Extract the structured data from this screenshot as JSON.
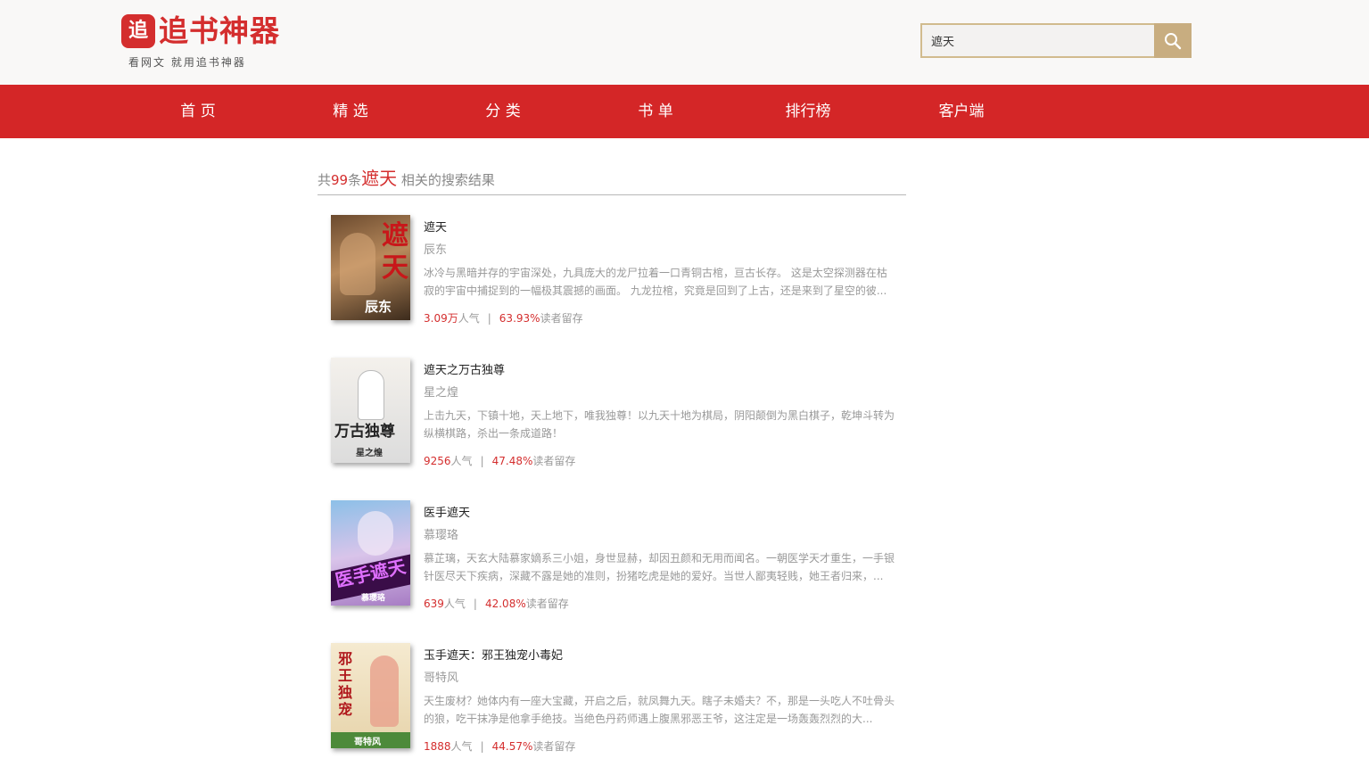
{
  "header": {
    "logo_mark": "追",
    "logo_name": "追书神器",
    "slogan": "看网文 就用追书神器",
    "search": {
      "value": "遮天",
      "button_icon": "search-icon"
    }
  },
  "nav": {
    "items": [
      {
        "label": "首 页"
      },
      {
        "label": "精 选"
      },
      {
        "label": "分 类"
      },
      {
        "label": "书 单"
      },
      {
        "label": "排行榜"
      },
      {
        "label": "客户端"
      }
    ]
  },
  "results": {
    "prefix": "共",
    "count": "99",
    "middle": "条",
    "keyword": "遮天",
    "suffix": " 相关的搜索结果"
  },
  "books": [
    {
      "title": "遮天",
      "author": "辰东",
      "desc": "冰冷与黑暗并存的宇宙深处，九具庞大的龙尸拉着一口青铜古棺，亘古长存。 这是太空探测器在枯寂的宇宙中捕捉到的一幅极其震撼的画面。 九龙拉棺，究竟是回到了上古，还是来到了星空的彼...",
      "popularity_num": "3.09万",
      "popularity_label": "人气",
      "retention_num": "63.93%",
      "retention_label": "读者留存",
      "cover_text": "遮天",
      "cover_author": "辰东",
      "colors": {
        "bg1": "#8a5a38",
        "bg2": "#e0b98b",
        "title": "#c8171a"
      }
    },
    {
      "title": "遮天之万古独尊",
      "author": "星之煌",
      "desc": "上击九天，下镇十地，天上地下，唯我独尊！以九天十地为棋局，阴阳颠倒为黑白棋子，乾坤斗转为纵横棋路，杀出一条成道路！",
      "popularity_num": "9256",
      "popularity_label": "人气",
      "retention_num": "47.48%",
      "retention_label": "读者留存",
      "cover_text": "万古独尊",
      "cover_author": "星之煌",
      "colors": {
        "bg1": "#f4f1ec",
        "bg2": "#d8d8d8",
        "title": "#222222"
      }
    },
    {
      "title": "医手遮天",
      "author": "慕璎珞",
      "desc": "慕芷璃，天玄大陆慕家嫡系三小姐，身世显赫，却因丑颜和无用而闻名。一朝医学天才重生，一手银针医尽天下疾病，深藏不露是她的准则，扮猪吃虎是她的爱好。当世人鄙夷轻贱，她王者归来，...",
      "popularity_num": "639",
      "popularity_label": "人气",
      "retention_num": "42.08%",
      "retention_label": "读者留存",
      "cover_text": "医手遮天",
      "cover_author": "慕璎珞",
      "colors": {
        "bg1": "#7fb5e0",
        "bg2": "#c7a6d8",
        "title": "#7a1a8c"
      }
    },
    {
      "title": "玉手遮天：邪王独宠小毒妃",
      "author": "哥特风",
      "desc": "天生废材？她体内有一座大宝藏，开启之后，就凤舞九天。瞎子未婚夫？不，那是一头吃人不吐骨头的狼，吃干抹净是他拿手绝技。当绝色丹药师遇上腹黑邪恶王爷，这注定是一场轰轰烈烈的大...",
      "popularity_num": "1888",
      "popularity_label": "人气",
      "retention_num": "44.57%",
      "retention_label": "读者留存",
      "cover_text": "邪王独宠",
      "cover_author": "哥特风",
      "colors": {
        "bg1": "#f2e6c9",
        "bg2": "#e6d2a8",
        "title": "#b0181c"
      }
    }
  ]
}
